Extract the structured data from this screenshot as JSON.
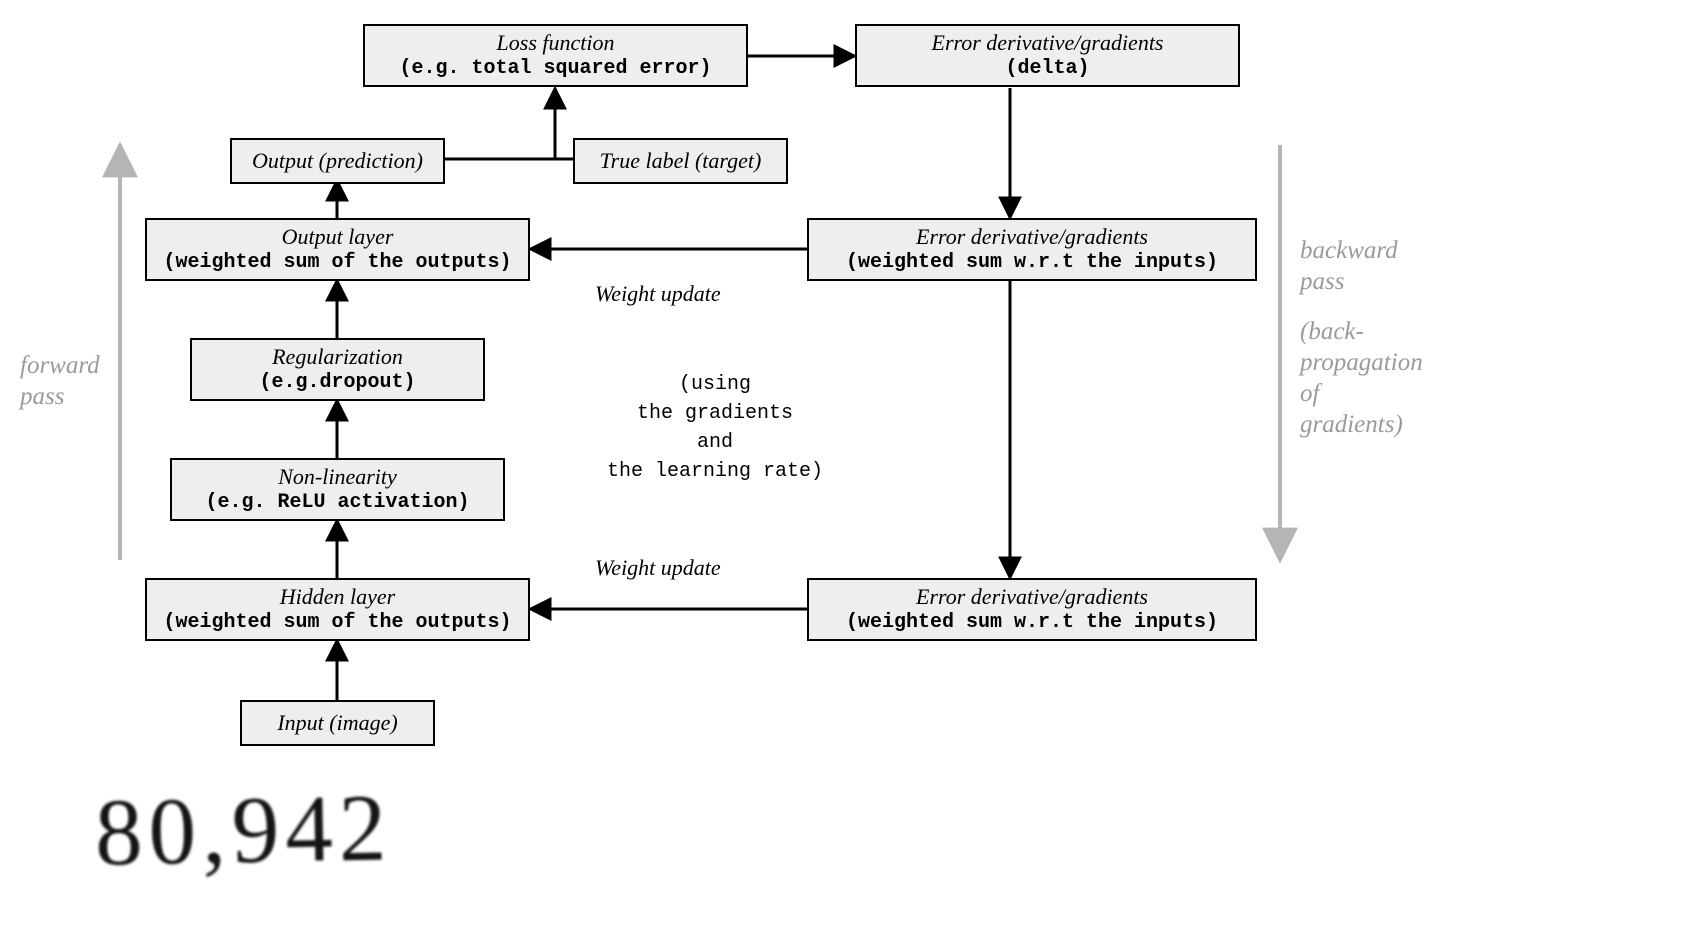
{
  "boxes": {
    "loss_function": {
      "title": "Loss function",
      "sub": "(e.g. total squared error)"
    },
    "error_delta": {
      "title": "Error derivative/gradients",
      "sub": "(delta)"
    },
    "output_pred": {
      "title": "Output (prediction)"
    },
    "true_label": {
      "title": "True label (target)"
    },
    "output_layer": {
      "title": "Output layer",
      "sub": "(weighted sum of the outputs)"
    },
    "error_top": {
      "title": "Error derivative/gradients",
      "sub": "(weighted sum w.r.t the inputs)"
    },
    "regularization": {
      "title": "Regularization",
      "sub": "(e.g.dropout)"
    },
    "nonlinearity": {
      "title": "Non-linearity",
      "sub": "(e.g. ReLU activation)"
    },
    "hidden_layer": {
      "title": "Hidden layer",
      "sub": "(weighted sum of the outputs)"
    },
    "error_bottom": {
      "title": "Error derivative/gradients",
      "sub": "(weighted sum w.r.t the inputs)"
    },
    "input_image": {
      "title": "Input (image)"
    }
  },
  "labels": {
    "forward_pass_l1": "forward",
    "forward_pass_l2": "pass",
    "backward_l1": "backward",
    "backward_l2": "pass",
    "backward_l3": "(back-",
    "backward_l4": "propagation",
    "backward_l5": "of",
    "backward_l6": "gradients)",
    "weight_update_1": "Weight update",
    "weight_update_2": "Weight update",
    "center_l1": "(using",
    "center_l2": "the gradients",
    "center_l3": "and",
    "center_l4": "the learning rate)"
  },
  "handwritten": "80,942"
}
